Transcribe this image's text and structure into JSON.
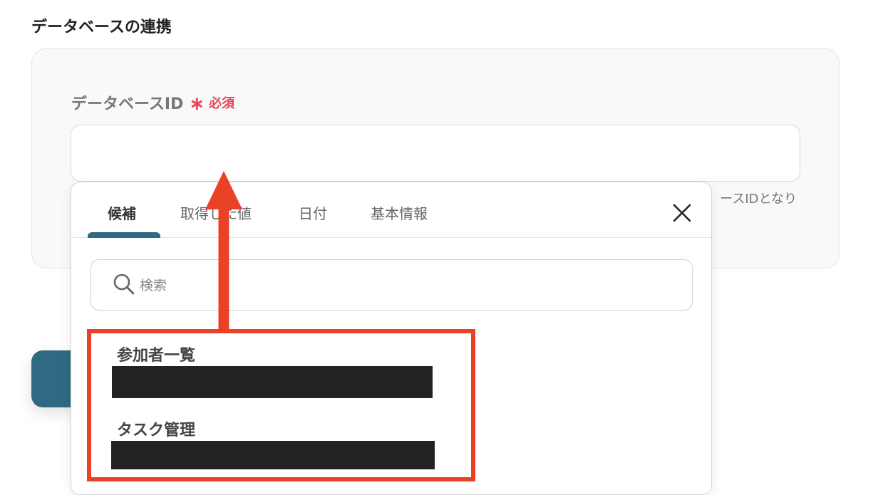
{
  "section": {
    "title": "データベースの連携"
  },
  "field": {
    "label": "データベースID",
    "required_star": "∗",
    "required_text": "必須",
    "value": "",
    "hint": "ースIDとなり"
  },
  "popup": {
    "tabs": [
      {
        "label": "候補",
        "active": true
      },
      {
        "label": "取得した値",
        "active": false
      },
      {
        "label": "日付",
        "active": false
      },
      {
        "label": "基本情報",
        "active": false
      }
    ],
    "search_placeholder": "検索",
    "items": [
      {
        "title": "参加者一覧"
      },
      {
        "title": "タスク管理"
      }
    ]
  },
  "colors": {
    "accent": "#2f6a82",
    "required": "#e8485a",
    "annotation": "#ea4127"
  }
}
